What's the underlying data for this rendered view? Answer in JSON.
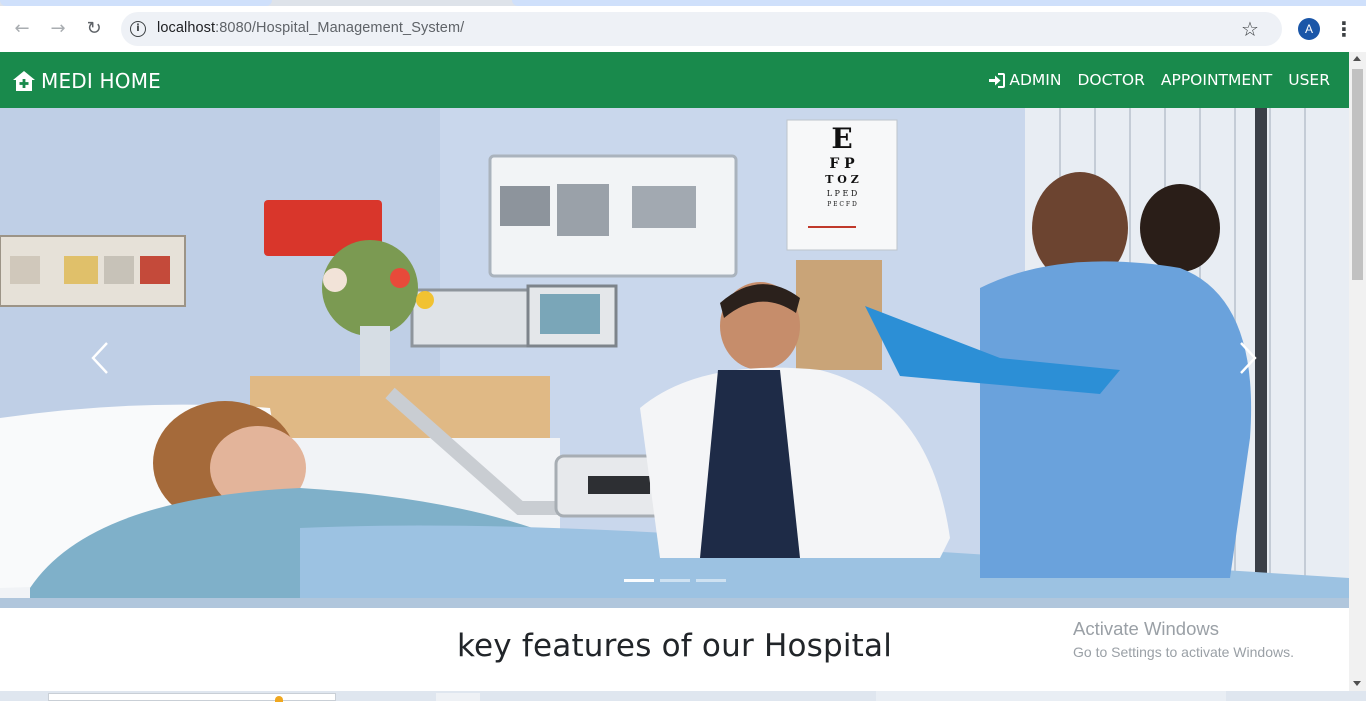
{
  "browser": {
    "url_host": "localhost",
    "url_path": ":8080/Hospital_Management_System/",
    "avatar_letter": "A",
    "icons": [
      "back-arrow-icon",
      "forward-arrow-icon",
      "reload-icon",
      "site-info-icon",
      "bookmark-star-icon",
      "kebab-menu-icon"
    ]
  },
  "navbar": {
    "brand": "MEDI HOME",
    "brand_icon": "house-medical-icon",
    "links": [
      "ADMIN",
      "DOCTOR",
      "APPOINTMENT",
      "USER"
    ],
    "admin_icon": "sign-in-icon",
    "background": "#198a4c"
  },
  "carousel": {
    "slide_count": 3,
    "active_index": 0,
    "prev_icon": "chevron-left-icon",
    "next_icon": "chevron-right-icon",
    "eye_chart_text": [
      "E",
      "F P",
      "T O Z",
      "L P E D",
      "P E C F D"
    ]
  },
  "features": {
    "title": "key features of our Hospital"
  },
  "windows_watermark": {
    "line1": "Activate Windows",
    "line2": "Go to Settings to activate Windows."
  }
}
